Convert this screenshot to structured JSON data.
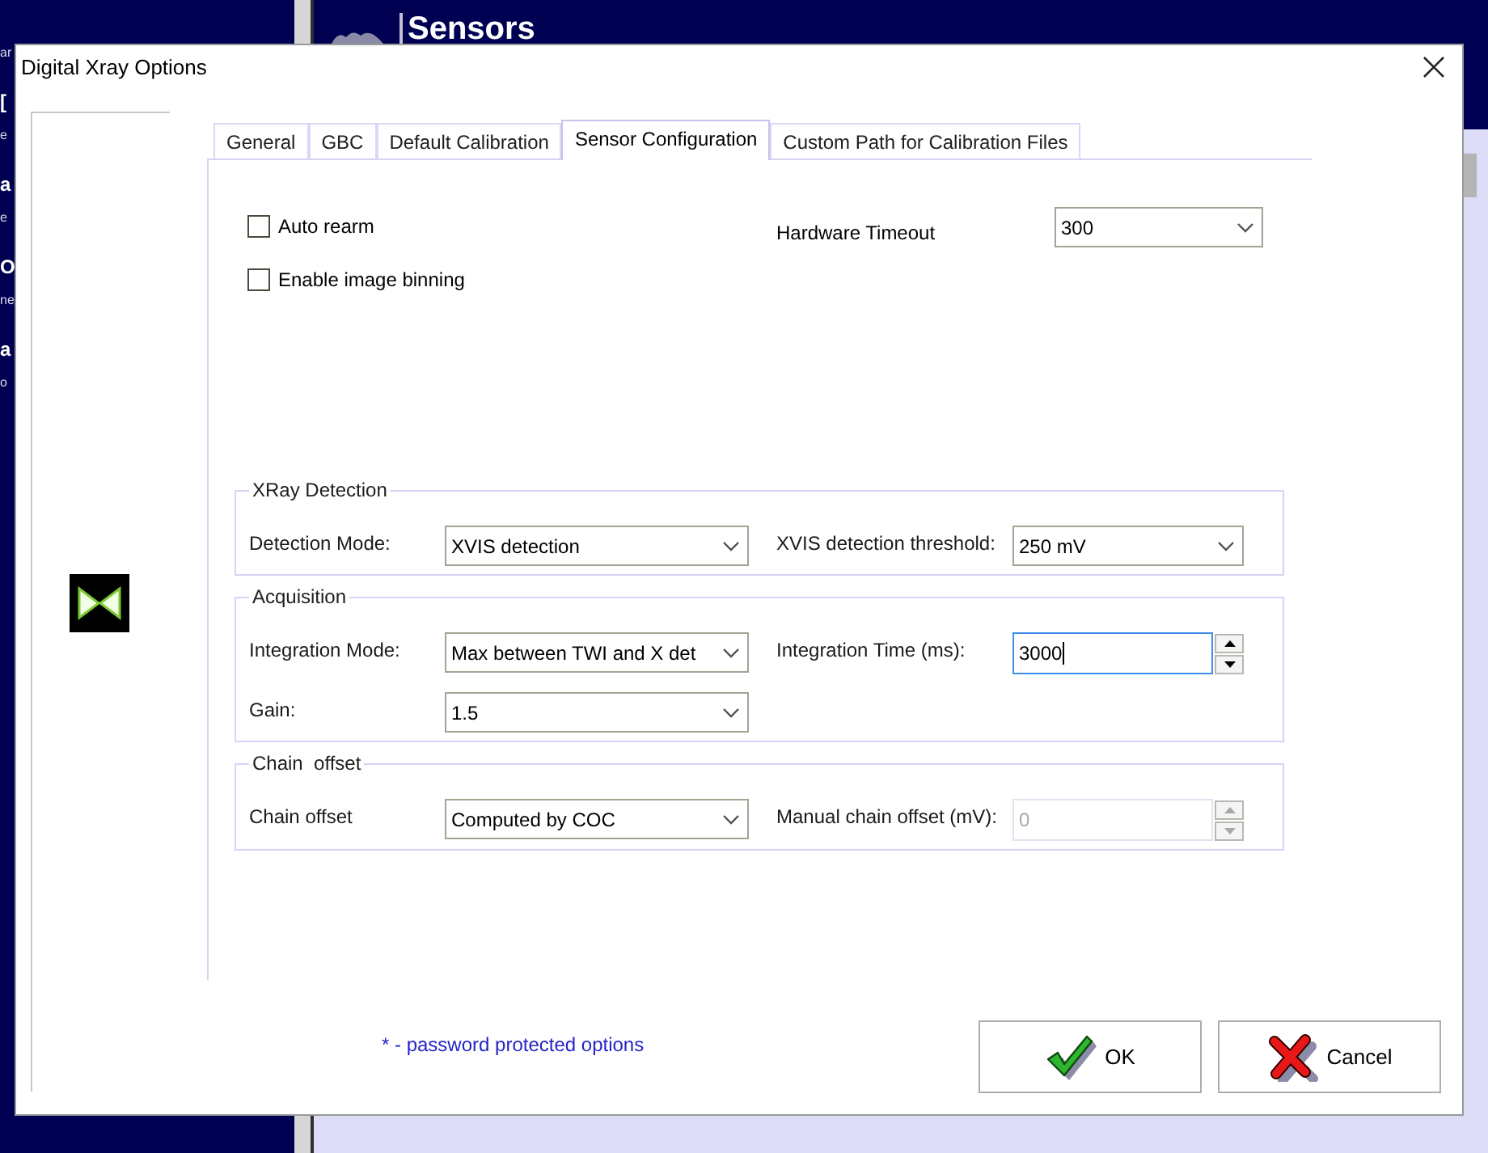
{
  "desktop": {
    "fragments": {
      "header": "ar",
      "items": [
        {
          "title": "[",
          "subtitle": "e"
        },
        {
          "title": "a",
          "subtitle": "e"
        },
        {
          "title": "O",
          "subtitle": "ne"
        },
        {
          "title": "a",
          "subtitle": "o"
        }
      ]
    }
  },
  "background_window": {
    "title": "Sensors"
  },
  "dialog": {
    "title": "Digital Xray Options"
  },
  "tabs": [
    {
      "label": "General",
      "selected": false
    },
    {
      "label": "GBC",
      "selected": false
    },
    {
      "label": "Default Calibration",
      "selected": false
    },
    {
      "label": "Sensor Configuration",
      "selected": true
    },
    {
      "label": "Custom Path for Calibration Files",
      "selected": false
    }
  ],
  "sensor_configuration": {
    "checkboxes": [
      {
        "label": "Auto rearm",
        "checked": false
      },
      {
        "label": "Enable image binning",
        "checked": false
      }
    ],
    "hardware_timeout": {
      "label": "Hardware Timeout",
      "value": "300"
    },
    "groups": [
      {
        "title": "XRay Detection",
        "rows": [
          {
            "fields": [
              {
                "kind": "dropdown",
                "label": "Detection Mode:",
                "value": "XVIS detection"
              },
              {
                "kind": "dropdown",
                "label": "XVIS detection threshold:",
                "value": "250 mV"
              }
            ]
          }
        ]
      },
      {
        "title": "Acquisition",
        "rows": [
          {
            "fields": [
              {
                "kind": "dropdown",
                "label": "Integration Mode:",
                "value": "Max between TWI and X det"
              },
              {
                "kind": "spinbox",
                "label": "Integration Time (ms):",
                "value": "3000",
                "focused": true,
                "disabled": false
              }
            ]
          },
          {
            "fields": [
              {
                "kind": "dropdown",
                "label": "Gain:",
                "value": "1.5"
              }
            ]
          }
        ]
      },
      {
        "title": "Chain  offset",
        "rows": [
          {
            "fields": [
              {
                "kind": "dropdown",
                "label": "Chain offset",
                "value": "Computed by COC"
              },
              {
                "kind": "spinbox",
                "label": "Manual chain offset (mV):",
                "value": "0",
                "focused": false,
                "disabled": true
              }
            ]
          }
        ]
      }
    ]
  },
  "note": "* - password protected options",
  "buttons": [
    {
      "kind": "ok",
      "label": "OK"
    },
    {
      "kind": "cancel",
      "label": "Cancel"
    }
  ]
}
